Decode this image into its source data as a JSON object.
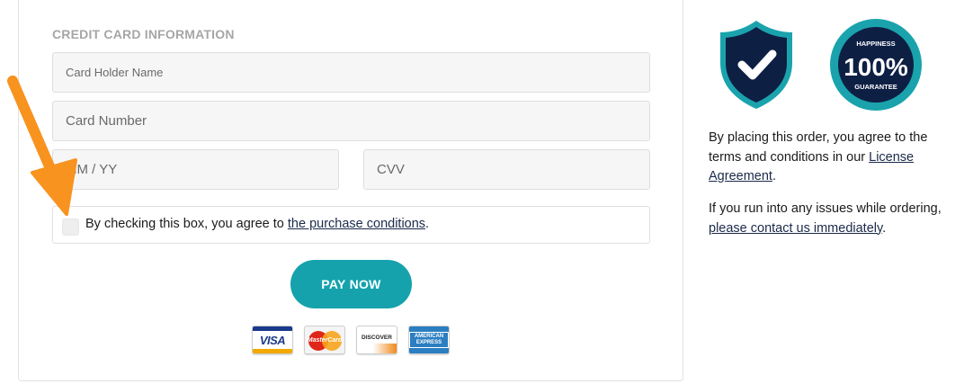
{
  "form": {
    "section_title": "CREDIT CARD INFORMATION",
    "card_holder_placeholder": "Card Holder Name",
    "card_number_placeholder": "Card Number",
    "expiry_placeholder": "MM / YY",
    "cvv_placeholder": "CVV",
    "agree_text": "By checking this box, you agree to ",
    "agree_link": "the purchase conditions",
    "agree_suffix": ".",
    "pay_button": "PAY NOW",
    "checkbox_checked": false
  },
  "card_logos": [
    {
      "name": "visa-logo",
      "text": "VISA"
    },
    {
      "name": "mastercard-logo",
      "text": "MasterCard"
    },
    {
      "name": "discover-logo",
      "text": "DISCOVER"
    },
    {
      "name": "amex-logo",
      "text": "AMERICAN EXPRESS"
    }
  ],
  "badges": {
    "seal_top": "HAPPINESS",
    "seal_main": "100%",
    "seal_bottom": "GUARANTEE",
    "shield_color": "#0e1f44",
    "accent_color": "#1aa3ad"
  },
  "info": {
    "terms_text": "By placing this order, you agree to the terms and conditions in our ",
    "terms_link": "License Agreement",
    "terms_suffix": ".",
    "issues_text": "If you run into any issues while ordering, ",
    "issues_link": "please contact us immediately",
    "issues_suffix": "."
  },
  "colors": {
    "pay_button": "#15a2ad",
    "arrow": "#f7931e"
  }
}
